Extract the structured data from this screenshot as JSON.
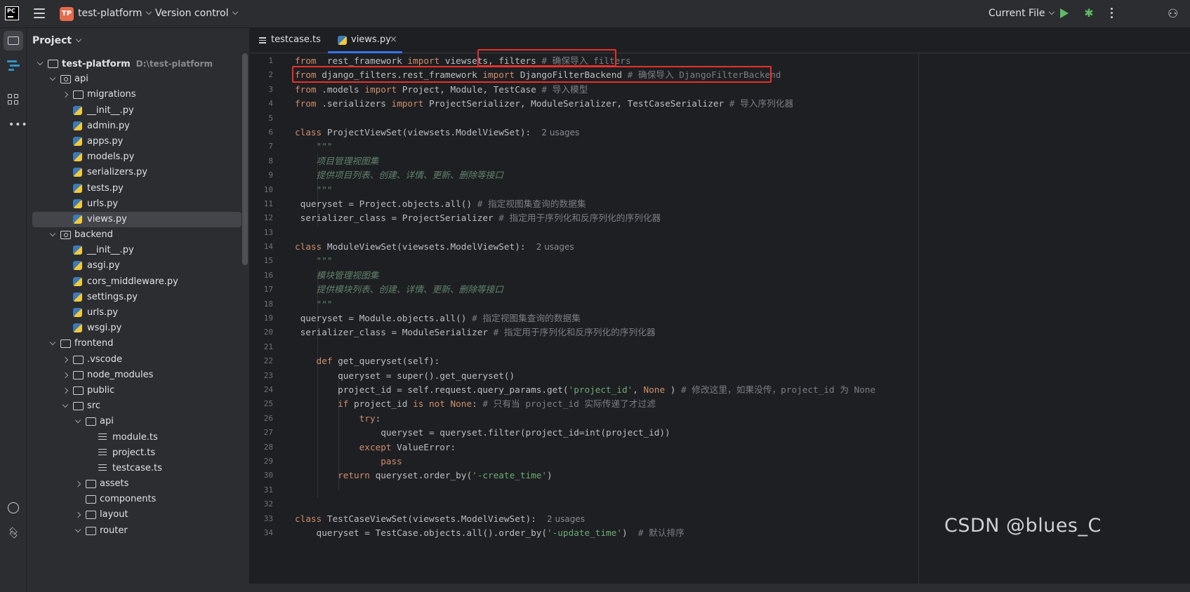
{
  "titlebar": {
    "app_logo_text": "PC",
    "project_badge": "TP",
    "project_name": "test-platform",
    "vcs_label": "Version control",
    "run_config": "Current File"
  },
  "project_panel": {
    "header": "Project",
    "tree": [
      {
        "label": "test-platform",
        "path": "D:\\test-platform",
        "depth": 0,
        "kind": "folder",
        "state": "open",
        "bold": true
      },
      {
        "label": "api",
        "depth": 1,
        "kind": "pkg",
        "state": "open"
      },
      {
        "label": "migrations",
        "depth": 2,
        "kind": "folder",
        "state": "closed"
      },
      {
        "label": "__init__.py",
        "depth": 2,
        "kind": "py"
      },
      {
        "label": "admin.py",
        "depth": 2,
        "kind": "py"
      },
      {
        "label": "apps.py",
        "depth": 2,
        "kind": "py"
      },
      {
        "label": "models.py",
        "depth": 2,
        "kind": "py"
      },
      {
        "label": "serializers.py",
        "depth": 2,
        "kind": "py"
      },
      {
        "label": "tests.py",
        "depth": 2,
        "kind": "py"
      },
      {
        "label": "urls.py",
        "depth": 2,
        "kind": "py"
      },
      {
        "label": "views.py",
        "depth": 2,
        "kind": "py",
        "selected": true
      },
      {
        "label": "backend",
        "depth": 1,
        "kind": "pkg",
        "state": "open"
      },
      {
        "label": "__init__.py",
        "depth": 2,
        "kind": "py"
      },
      {
        "label": "asgi.py",
        "depth": 2,
        "kind": "py"
      },
      {
        "label": "cors_middleware.py",
        "depth": 2,
        "kind": "py"
      },
      {
        "label": "settings.py",
        "depth": 2,
        "kind": "py"
      },
      {
        "label": "urls.py",
        "depth": 2,
        "kind": "py"
      },
      {
        "label": "wsgi.py",
        "depth": 2,
        "kind": "py"
      },
      {
        "label": "frontend",
        "depth": 1,
        "kind": "folder",
        "state": "open"
      },
      {
        "label": ".vscode",
        "depth": 2,
        "kind": "folder",
        "state": "closed"
      },
      {
        "label": "node_modules",
        "depth": 2,
        "kind": "folder",
        "state": "closed"
      },
      {
        "label": "public",
        "depth": 2,
        "kind": "folder",
        "state": "closed"
      },
      {
        "label": "src",
        "depth": 2,
        "kind": "folder",
        "state": "open"
      },
      {
        "label": "api",
        "depth": 3,
        "kind": "folder",
        "state": "open"
      },
      {
        "label": "module.ts",
        "depth": 4,
        "kind": "ts"
      },
      {
        "label": "project.ts",
        "depth": 4,
        "kind": "ts"
      },
      {
        "label": "testcase.ts",
        "depth": 4,
        "kind": "ts"
      },
      {
        "label": "assets",
        "depth": 3,
        "kind": "folder",
        "state": "closed"
      },
      {
        "label": "components",
        "depth": 3,
        "kind": "folder",
        "state": "none"
      },
      {
        "label": "layout",
        "depth": 3,
        "kind": "folder",
        "state": "closed"
      },
      {
        "label": "router",
        "depth": 3,
        "kind": "folder",
        "state": "open"
      }
    ]
  },
  "tabs": [
    {
      "label": "testcase.ts",
      "active": false
    },
    {
      "label": "views.py",
      "active": true,
      "close": "×"
    }
  ],
  "editor": {
    "line_numbers": [
      "1",
      "2",
      "3",
      "4",
      "5",
      "6",
      "7",
      "8",
      "9",
      "10",
      "11",
      "12",
      "13",
      "14",
      "15",
      "16",
      "17",
      "18",
      "19",
      "20",
      "21",
      "22",
      "23",
      "24",
      "25",
      "26",
      "27",
      "28",
      "29",
      "30",
      "31",
      "32",
      "33",
      "34"
    ],
    "lines": [
      [
        [
          "kw",
          "from"
        ],
        [
          "",
          "  rest_framework "
        ],
        [
          "kw",
          "import"
        ],
        [
          "",
          " viewsets, filters "
        ],
        [
          "cm",
          "# 确保导入 filters"
        ]
      ],
      [
        [
          "kw",
          "from"
        ],
        [
          "",
          " django_filters.rest_framework "
        ],
        [
          "kw",
          "import"
        ],
        [
          "",
          " DjangoFilterBackend "
        ],
        [
          "cm",
          "# 确保导入 DjangoFilterBackend"
        ]
      ],
      [
        [
          "kw",
          "from"
        ],
        [
          "",
          " .models "
        ],
        [
          "kw",
          "import"
        ],
        [
          "",
          " Project, Module, TestCase "
        ],
        [
          "cm",
          "# 导入模型"
        ]
      ],
      [
        [
          "kw",
          "from"
        ],
        [
          "",
          " .serializers "
        ],
        [
          "kw",
          "import"
        ],
        [
          "",
          " ProjectSerializer, ModuleSerializer, TestCaseSerializer "
        ],
        [
          "cm",
          "# 导入序列化器"
        ]
      ],
      [],
      [
        [
          "kw",
          "class"
        ],
        [
          "",
          " ProjectViewSet(viewsets.ModelViewSet):  "
        ],
        [
          "hint",
          "2 usages"
        ]
      ],
      [
        [
          "doc",
          "    \"\"\""
        ]
      ],
      [
        [
          "doc",
          "    项目管理视图集"
        ]
      ],
      [
        [
          "doc",
          "    提供项目列表、创建、详情、更新、删除等接口"
        ]
      ],
      [
        [
          "doc",
          "    \"\"\""
        ]
      ],
      [
        [
          "",
          " queryset = Project.objects.all() "
        ],
        [
          "cm",
          "# 指定视图集查询的数据集"
        ]
      ],
      [
        [
          "",
          " serializer_class = ProjectSerializer "
        ],
        [
          "cm",
          "# 指定用于序列化和反序列化的序列化器"
        ]
      ],
      [],
      [
        [
          "kw",
          "class"
        ],
        [
          "",
          " ModuleViewSet(viewsets.ModelViewSet):  "
        ],
        [
          "hint",
          "2 usages"
        ]
      ],
      [
        [
          "doc",
          "    \"\"\""
        ]
      ],
      [
        [
          "doc",
          "    模块管理视图集"
        ]
      ],
      [
        [
          "doc",
          "    提供模块列表、创建、详情、更新、删除等接口"
        ]
      ],
      [
        [
          "doc",
          "    \"\"\""
        ]
      ],
      [
        [
          "",
          " queryset = Module.objects.all() "
        ],
        [
          "cm",
          "# 指定视图集查询的数据集"
        ]
      ],
      [
        [
          "",
          " serializer_class = ModuleSerializer "
        ],
        [
          "cm",
          "# 指定用于序列化和反序列化的序列化器"
        ]
      ],
      [],
      [
        [
          "kw",
          "    def"
        ],
        [
          "",
          " get_queryset(self):"
        ]
      ],
      [
        [
          "",
          "        queryset = super().get_queryset()"
        ]
      ],
      [
        [
          "",
          "        project_id = self.request.query_params.get("
        ],
        [
          "str",
          "'project_id'"
        ],
        [
          "",
          ", "
        ],
        [
          "kw",
          "None"
        ],
        [
          "",
          " ) "
        ],
        [
          "cm",
          "# 修改这里，如果没传，project_id 为 None"
        ]
      ],
      [
        [
          "kw",
          "        if"
        ],
        [
          "",
          " project_id "
        ],
        [
          "kw",
          "is not None"
        ],
        [
          "",
          ": "
        ],
        [
          "cm",
          "# 只有当 project_id 实际传递了才过滤"
        ]
      ],
      [
        [
          "kw",
          "            try"
        ],
        [
          "",
          ":"
        ]
      ],
      [
        [
          "",
          "                queryset = queryset.filter(project_id=int(project_id))"
        ]
      ],
      [
        [
          "kw",
          "            except"
        ],
        [
          "",
          " ValueError:"
        ]
      ],
      [
        [
          "kw",
          "                pass"
        ]
      ],
      [
        [
          "kw",
          "        return"
        ],
        [
          "",
          " queryset.order_by("
        ],
        [
          "str",
          "'-create_time'"
        ],
        [
          "",
          ")"
        ]
      ],
      [],
      [],
      [
        [
          "kw",
          "class"
        ],
        [
          "",
          " TestCaseViewSet(viewsets.ModelViewSet):  "
        ],
        [
          "hint",
          "2 usages"
        ]
      ],
      [
        [
          "",
          "    queryset = TestCase.objects.all().order_by("
        ],
        [
          "str",
          "'-update_time'"
        ],
        [
          "",
          ")  "
        ],
        [
          "cm",
          "# 默认排序"
        ]
      ]
    ]
  },
  "watermark": "CSDN @blues_C"
}
